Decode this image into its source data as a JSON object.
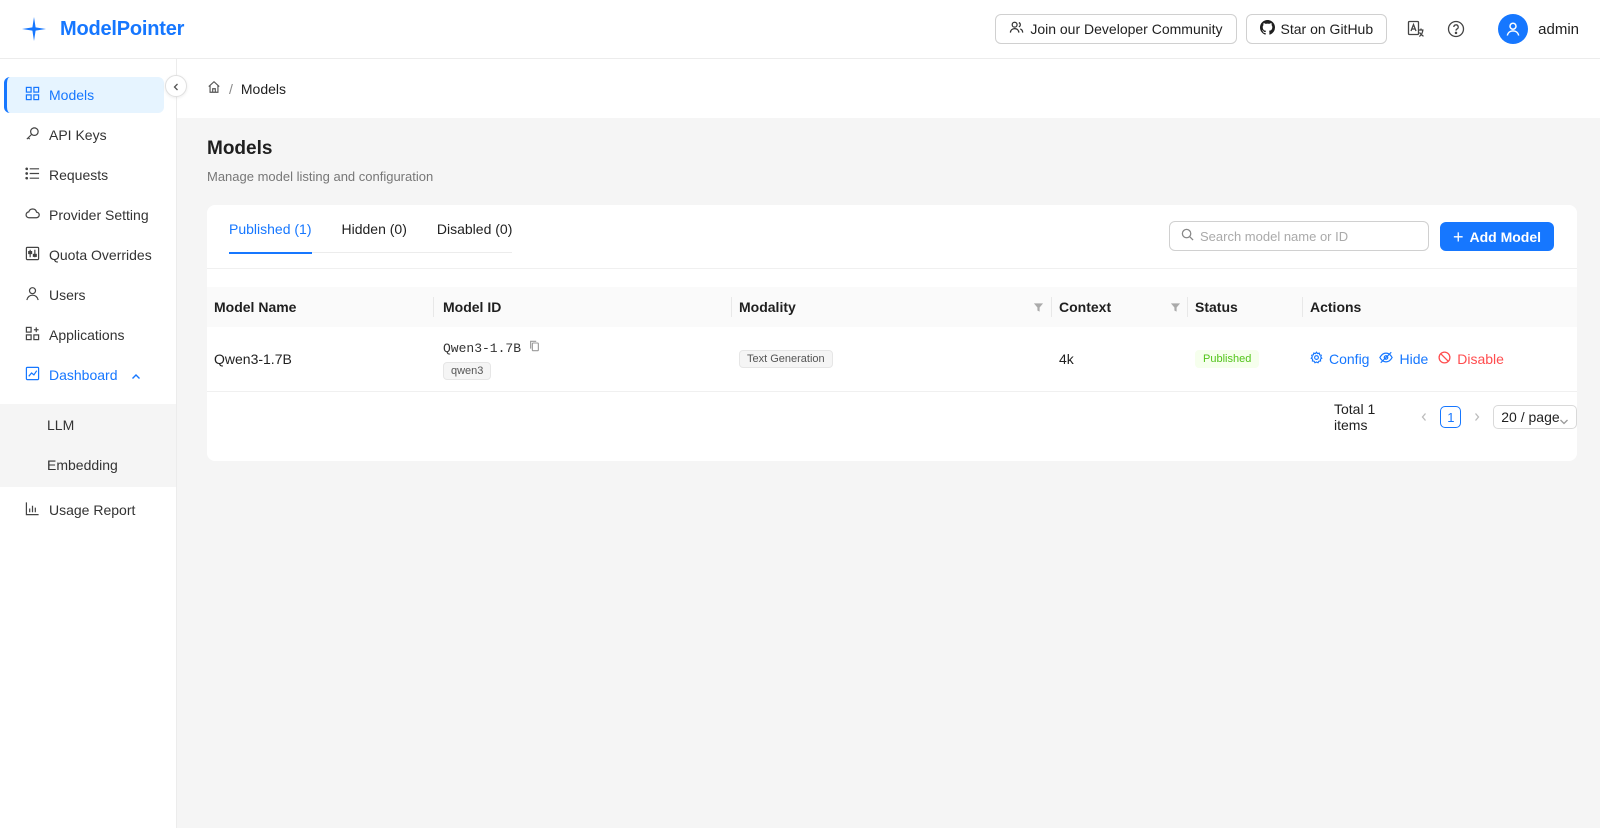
{
  "app": {
    "name": "ModelPointer",
    "accent": "#1677ff"
  },
  "header": {
    "community_label": "Join our Developer Community",
    "github_label": "Star on GitHub",
    "user_name": "admin"
  },
  "sidebar": {
    "items": [
      {
        "label": "Models",
        "icon": "grid-icon"
      },
      {
        "label": "API Keys",
        "icon": "key-icon"
      },
      {
        "label": "Requests",
        "icon": "list-icon"
      },
      {
        "label": "Provider Setting",
        "icon": "cloud-icon"
      },
      {
        "label": "Quota Overrides",
        "icon": "sliders-icon"
      },
      {
        "label": "Users",
        "icon": "user-icon"
      },
      {
        "label": "Applications",
        "icon": "apps-icon"
      },
      {
        "label": "Dashboard",
        "icon": "chart-icon"
      },
      {
        "label": "Usage Report",
        "icon": "bar-chart-icon"
      }
    ],
    "dashboard_children": [
      "LLM",
      "Embedding"
    ]
  },
  "breadcrumb": {
    "current": "Models"
  },
  "page": {
    "title": "Models",
    "description": "Manage model listing and configuration"
  },
  "tabs": [
    "Published (1)",
    "Hidden (0)",
    "Disabled (0)"
  ],
  "search": {
    "placeholder": "Search model name or ID"
  },
  "add_button": "Add Model",
  "table": {
    "columns": [
      "Model Name",
      "Model ID",
      "Modality",
      "Context",
      "Status",
      "Actions"
    ],
    "rows": [
      {
        "name": "Qwen3-1.7B",
        "id": "Qwen3-1.7B",
        "id_tag": "qwen3",
        "modality": "Text Generation",
        "context": "4k",
        "status": "Published",
        "actions": [
          "Config",
          "Hide",
          "Disable"
        ]
      }
    ]
  },
  "pagination": {
    "total": "Total 1 items",
    "current_page": "1",
    "page_size": "20 / page"
  }
}
